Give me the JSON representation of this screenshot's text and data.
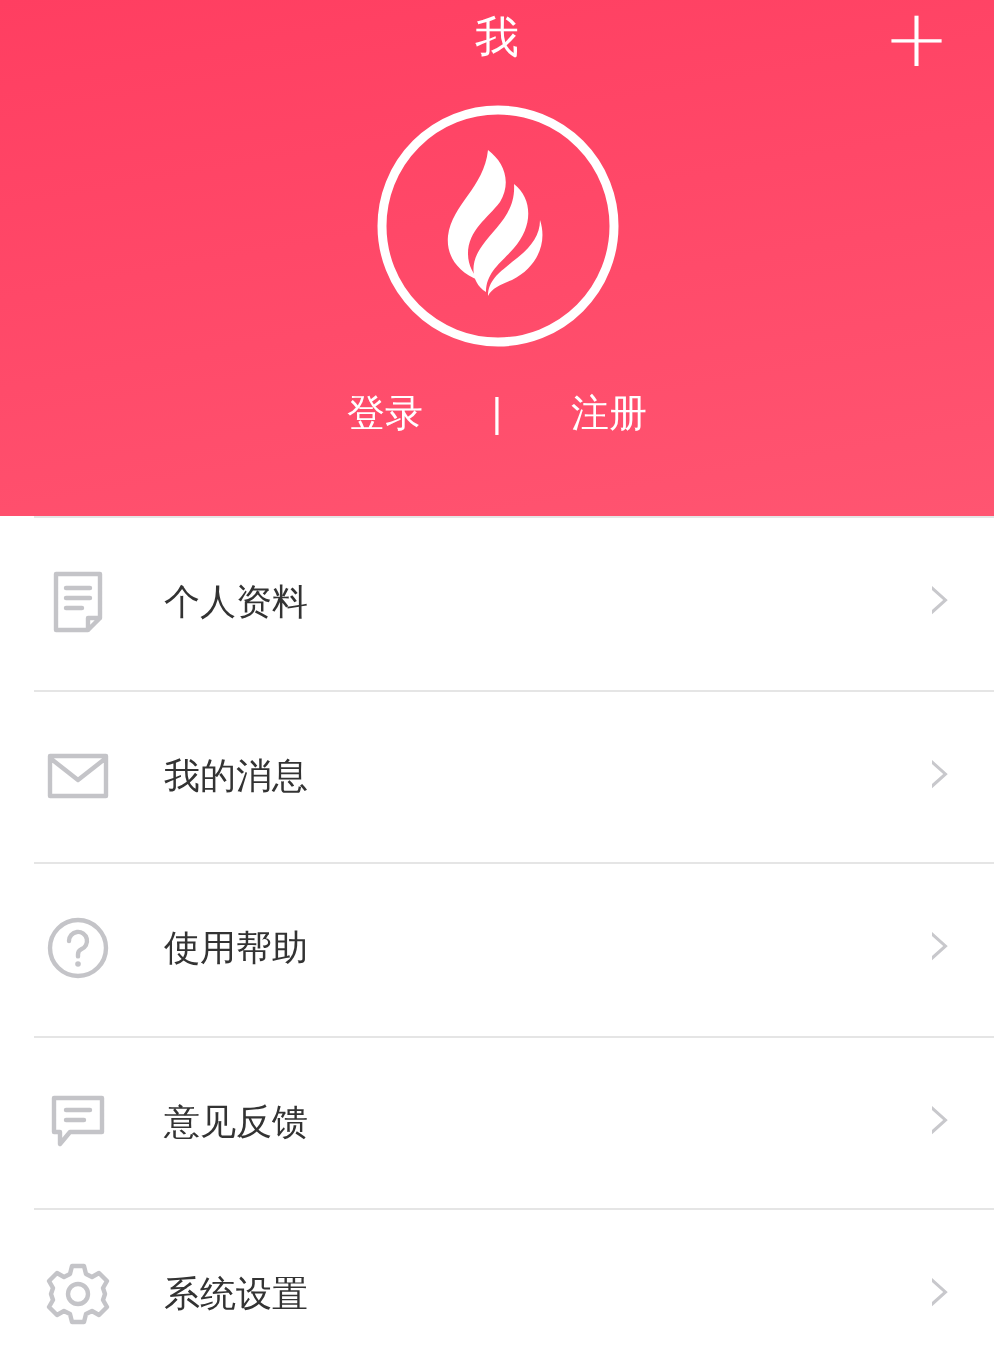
{
  "header": {
    "title": "我",
    "add_button": "+",
    "auth": {
      "login": "登录",
      "separator": "|",
      "register": "注册"
    }
  },
  "menu": [
    {
      "kind": "document",
      "label": "个人资料",
      "chevron": "›"
    },
    {
      "kind": "mail",
      "label": "我的消息",
      "chevron": "›"
    },
    {
      "kind": "help",
      "label": "使用帮助",
      "chevron": "›"
    },
    {
      "kind": "feedback",
      "label": "意见反馈",
      "chevron": "›"
    },
    {
      "kind": "settings",
      "label": "系统设置",
      "chevron": "›"
    }
  ]
}
